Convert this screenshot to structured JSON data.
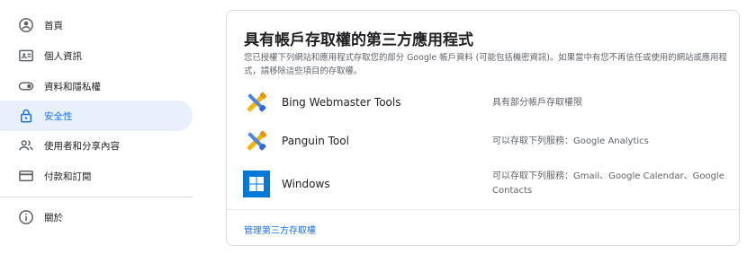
{
  "sidebar": {
    "items": [
      {
        "label": "首頁",
        "icon": "home-icon"
      },
      {
        "label": "個人資訊",
        "icon": "person-card-icon"
      },
      {
        "label": "資料和隱私權",
        "icon": "toggle-icon"
      },
      {
        "label": "安全性",
        "icon": "lock-icon",
        "active": true
      },
      {
        "label": "使用者和分享內容",
        "icon": "people-icon"
      },
      {
        "label": "付款和訂閱",
        "icon": "credit-card-icon"
      },
      {
        "label": "關於",
        "icon": "info-icon"
      }
    ]
  },
  "card": {
    "title": "具有帳戶存取權的第三方應用程式",
    "description": "您已授權下列網站和應用程式存取您的部分 Google 帳戶資料 (可能包括機密資訊)。如果當中有您不再信任或使用的網站或應用程式，請移除這些項目的存取權。",
    "apps": [
      {
        "name": "Bing Webmaster Tools",
        "access": "具有部分帳戶存取權限",
        "icon": "tools-cross-icon"
      },
      {
        "name": "Panguin Tool",
        "access": "可以存取下列服務：Google Analytics",
        "icon": "tools-cross-icon"
      },
      {
        "name": "Windows",
        "access": "可以存取下列服務：Gmail、Google Calendar、Google Contacts",
        "icon": "windows-logo-icon"
      }
    ],
    "manage_link": "管理第三方存取權"
  },
  "colors": {
    "accent": "#1a73e8",
    "active_bg": "#e8f0fe",
    "windows_blue": "#0078d7",
    "tool_yellow": "#f4b400",
    "tool_blue": "#4a86e8"
  }
}
